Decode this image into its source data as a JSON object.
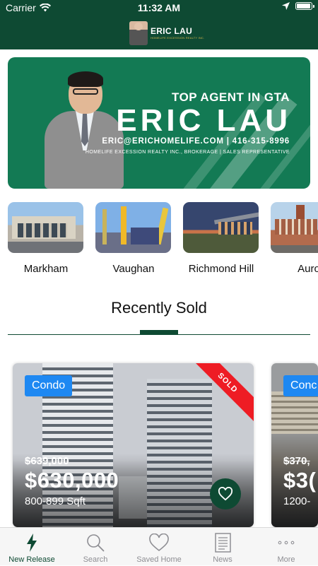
{
  "status_bar": {
    "carrier": "Carrier",
    "time": "11:32 AM",
    "battery_percent": 95
  },
  "header": {
    "brand_name": "ERIC LAU",
    "brand_sub": "HOMELIFE EXCESSION REALTY INC."
  },
  "banner": {
    "tagline": "TOP AGENT IN GTA",
    "name": "ERIC LAU",
    "contact": "ERIC@ERICHOMELIFE.COM  |  416-315-8996",
    "company": "HOMELIFE EXCESSION REALTY INC., BROKERAGE  |  SALES REPRESENTATIVE"
  },
  "regions": [
    {
      "label": "Markham"
    },
    {
      "label": "Vaughan"
    },
    {
      "label": "Richmond Hill"
    },
    {
      "label": "Auro"
    }
  ],
  "section": {
    "title": "Recently Sold"
  },
  "listings": [
    {
      "type": "Condo",
      "ribbon": "SOLD",
      "old_price": "$639,000",
      "price": "$630,000",
      "size": "800-899 Sqft"
    },
    {
      "type": "Conc",
      "old_price": "$370,",
      "price": "$3(",
      "size": "1200-"
    }
  ],
  "tabs": [
    {
      "label": "New Release",
      "icon": "bolt-icon",
      "active": true
    },
    {
      "label": "Search",
      "icon": "search-icon"
    },
    {
      "label": "Saved Home",
      "icon": "heart-icon"
    },
    {
      "label": "News",
      "icon": "newspaper-icon"
    },
    {
      "label": "More",
      "icon": "more-icon"
    }
  ],
  "colors": {
    "header": "#0e4a33",
    "banner": "#137a54",
    "badge": "#1e88f2",
    "ribbon": "#ee1c24",
    "tab_inactive": "#8e8e93"
  }
}
